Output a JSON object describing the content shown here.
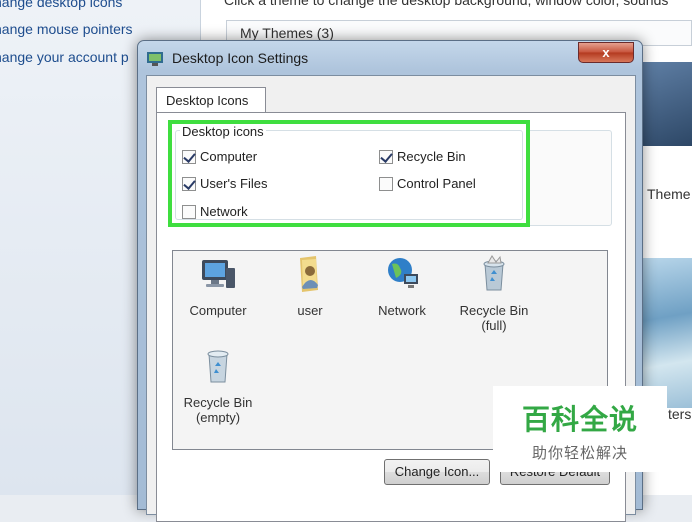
{
  "background": {
    "links": [
      "hange desktop icons",
      "hange mouse pointers",
      "hange your account p"
    ],
    "hint": "Click a theme to change the desktop background, window color, sounds",
    "my_themes": "My Themes (3)",
    "theme_label_1": "Theme",
    "theme_label_2": "ters"
  },
  "dialog": {
    "title": "Desktop Icon Settings",
    "close_label": "x",
    "tab_label": "Desktop Icons",
    "group_label": "Desktop icons",
    "checkboxes": [
      {
        "label": "Computer",
        "checked": true
      },
      {
        "label": "User's Files",
        "checked": true
      },
      {
        "label": "Network",
        "checked": false
      },
      {
        "label": "Recycle Bin",
        "checked": true
      },
      {
        "label": "Control Panel",
        "checked": false
      }
    ],
    "icons": [
      {
        "label": "Computer",
        "sub": "",
        "icon": "computer-icon"
      },
      {
        "label": "user",
        "sub": "",
        "icon": "user-folder-icon"
      },
      {
        "label": "Network",
        "sub": "",
        "icon": "network-icon"
      },
      {
        "label": "Recycle Bin",
        "sub": "(full)",
        "icon": "recycle-bin-full-icon"
      },
      {
        "label": "Recycle Bin",
        "sub": "(empty)",
        "icon": "recycle-bin-empty-icon"
      }
    ],
    "change_icon_label": "Change Icon...",
    "restore_default_label": "Restore Default"
  },
  "watermark": {
    "main": "百科全说",
    "sub": "助你轻松解决"
  },
  "colors": {
    "highlight": "#3fde3f",
    "watermark_green": "#33a845"
  }
}
